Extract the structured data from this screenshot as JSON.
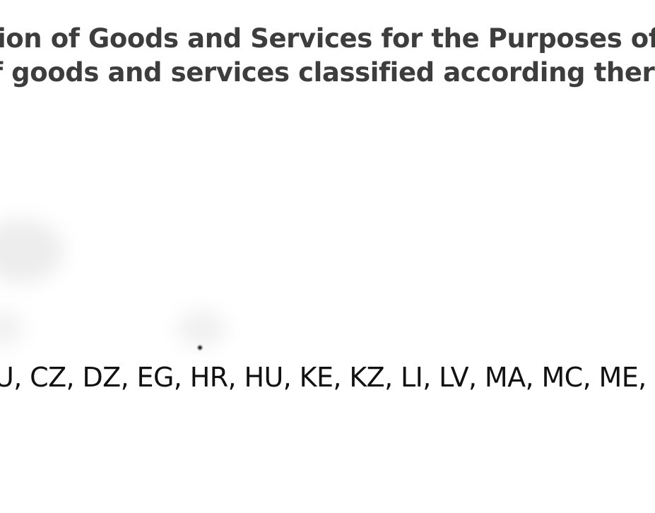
{
  "heading": {
    "line1": "ion of Goods and Services for the Purposes of the",
    "line2": "f goods and services classified according thereto-"
  },
  "designated_countries": "U, CZ, DZ, EG, HR, HU, KE, KZ, LI, LV, MA, MC, ME, F",
  "colors": {
    "heading_text": "#3d3d3d",
    "body_text": "#111111",
    "background": "#ffffff"
  }
}
